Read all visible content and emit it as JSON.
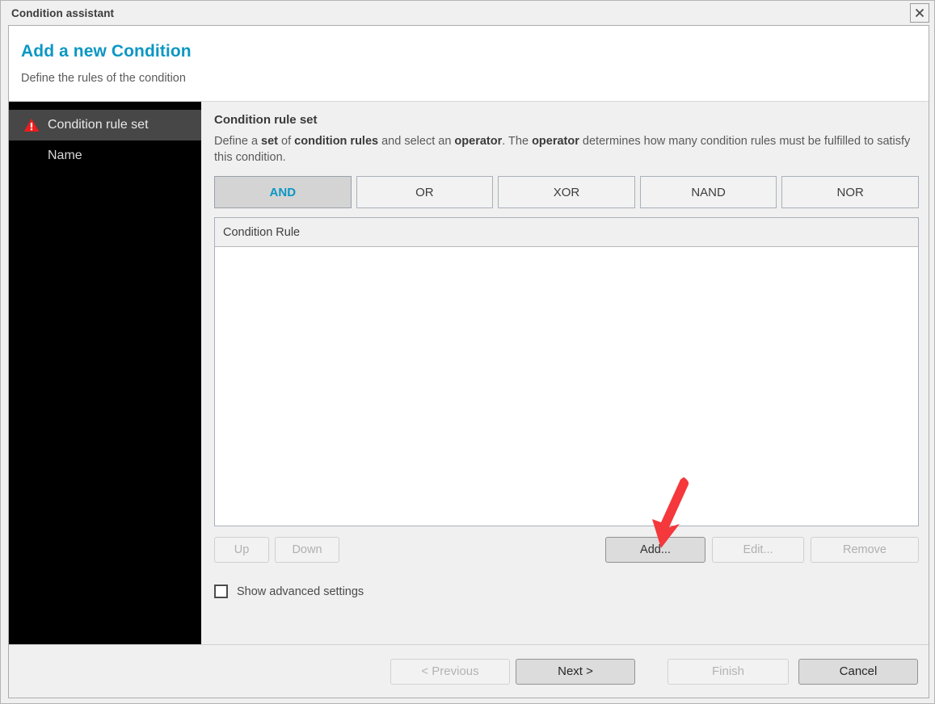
{
  "window": {
    "title": "Condition assistant",
    "close_icon": "close-icon"
  },
  "banner": {
    "title": "Add a new Condition",
    "subtitle": "Define the rules of the condition"
  },
  "sidebar": {
    "items": [
      {
        "label": "Condition rule set",
        "selected": true,
        "icon": "warning-triangle-icon"
      },
      {
        "label": "Name",
        "selected": false,
        "icon": ""
      }
    ]
  },
  "content": {
    "section_title": "Condition rule set",
    "description": {
      "p1": "Define a ",
      "b1": "set",
      "p2": " of ",
      "b2": "condition rules",
      "p3": " and select an ",
      "b3": "operator",
      "p4": ". The ",
      "b4": "operator",
      "p5": " determines how many condition rules must be fulfilled to satisfy this condition."
    },
    "operators": [
      {
        "label": "AND",
        "selected": true
      },
      {
        "label": "OR",
        "selected": false
      },
      {
        "label": "XOR",
        "selected": false
      },
      {
        "label": "NAND",
        "selected": false
      },
      {
        "label": "NOR",
        "selected": false
      }
    ],
    "table": {
      "columns": [
        "Condition Rule"
      ],
      "rows": []
    },
    "list_actions": {
      "up": "Up",
      "down": "Down",
      "add": "Add...",
      "edit": "Edit...",
      "remove": "Remove"
    },
    "advanced": {
      "label": "Show advanced settings",
      "checked": false
    }
  },
  "footer": {
    "previous": "< Previous",
    "next": "Next >",
    "finish": "Finish",
    "cancel": "Cancel"
  },
  "annotation": {
    "type": "arrow",
    "color": "#f4383c",
    "points_to": "Add..."
  },
  "colors": {
    "accent": "#0b97c4",
    "sidebar_bg": "#000000",
    "sidebar_selected": "#474747",
    "panel_bg": "#f0f0f0",
    "warning": "#ee1c1c",
    "annotation": "#f4383c"
  }
}
